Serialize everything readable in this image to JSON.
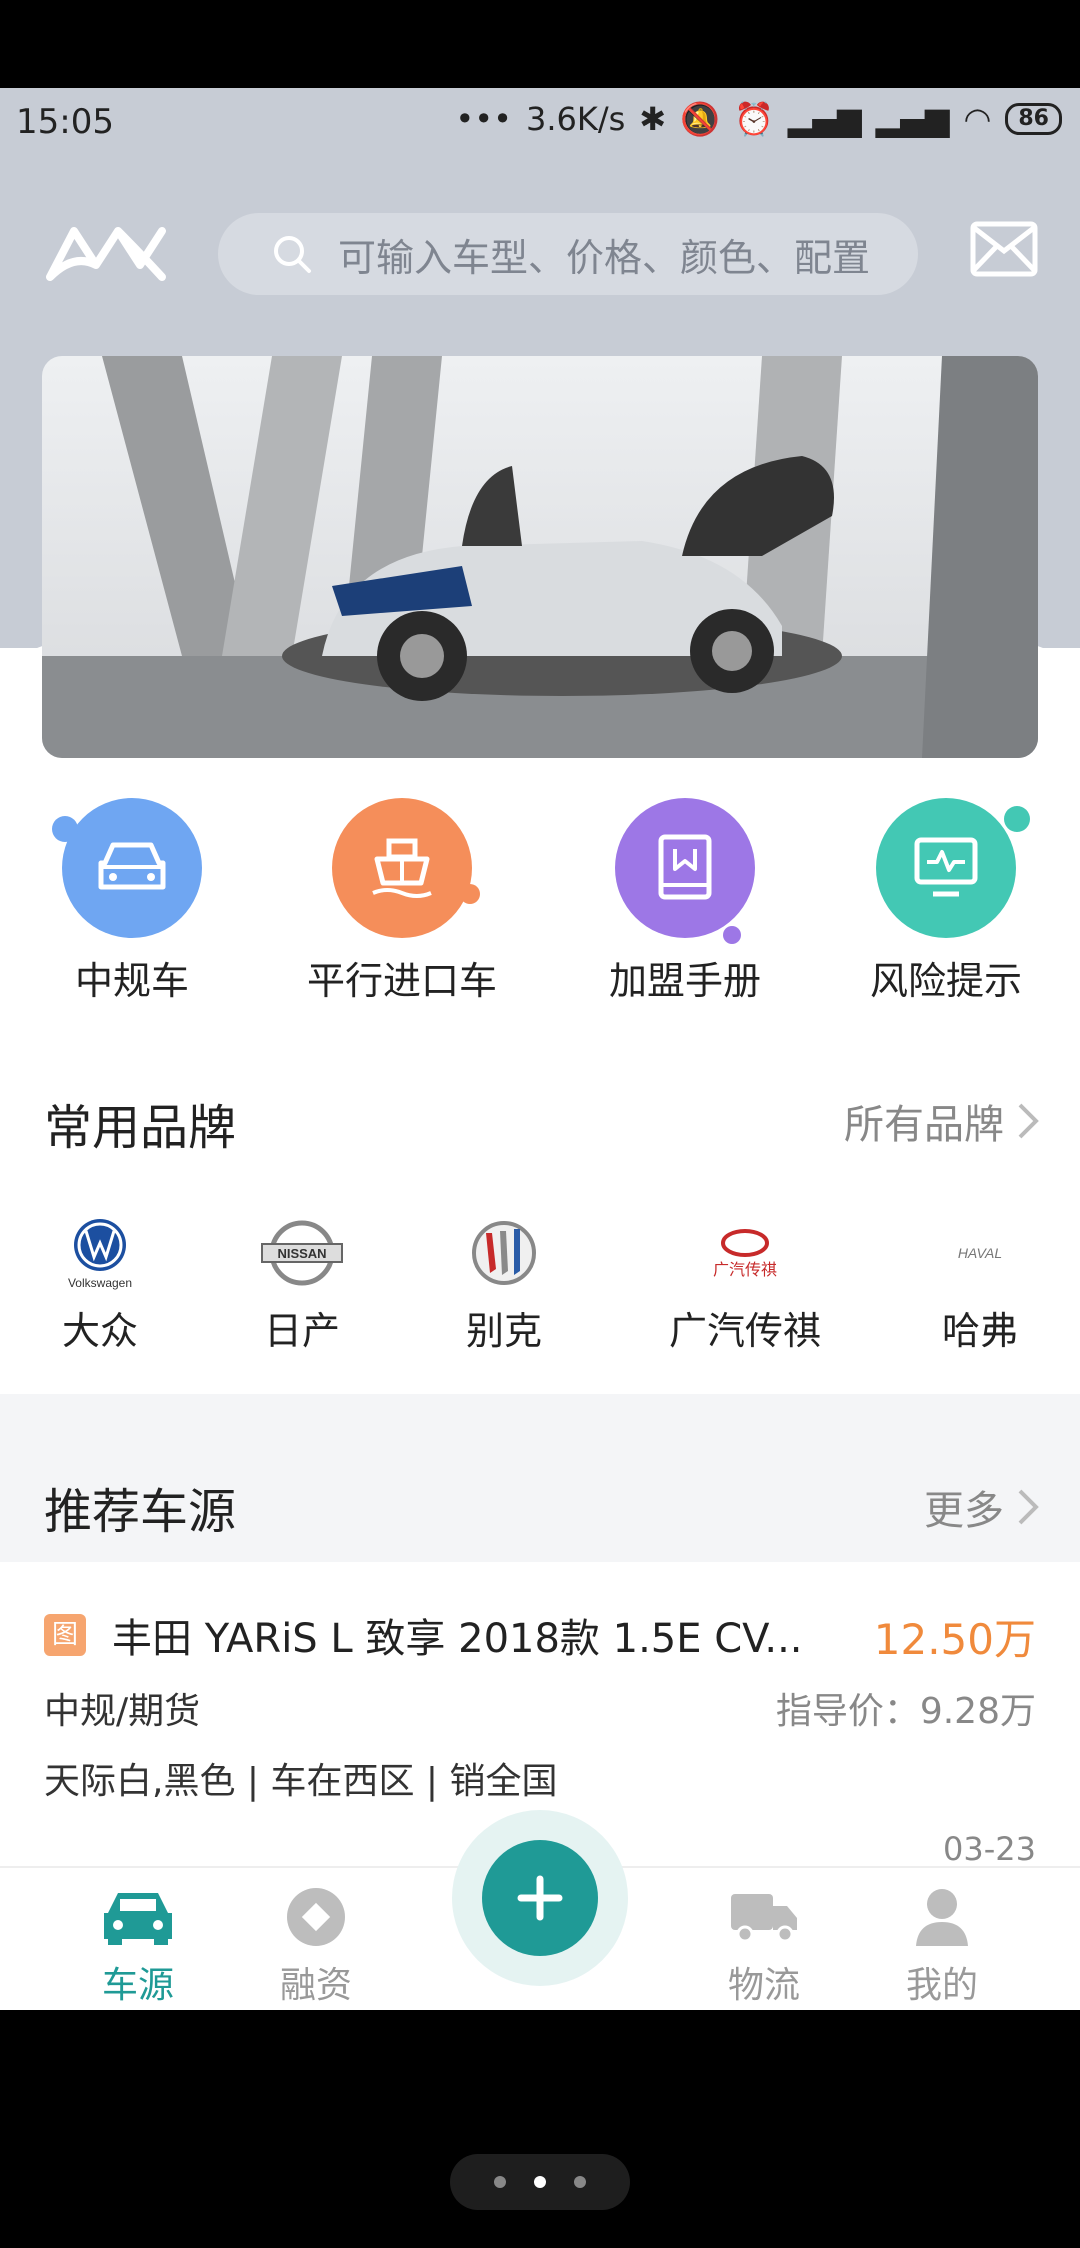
{
  "status_bar": {
    "time": "15:05",
    "network_speed": "3.6K/s",
    "battery": "86"
  },
  "search": {
    "placeholder": "可输入车型、价格、颜色、配置"
  },
  "categories": [
    {
      "label": "中规车",
      "icon": "car-icon",
      "color": "#6fa6f2"
    },
    {
      "label": "平行进口车",
      "icon": "ship-icon",
      "color": "#f58e5a"
    },
    {
      "label": "加盟手册",
      "icon": "book-icon",
      "color": "#9d77e6"
    },
    {
      "label": "风险提示",
      "icon": "monitor-icon",
      "color": "#43c8b4"
    }
  ],
  "brands_section": {
    "title": "常用品牌",
    "more": "所有品牌",
    "brands": [
      {
        "label": "大众",
        "logo_text": "Volkswagen"
      },
      {
        "label": "日产",
        "logo_text": "NISSAN"
      },
      {
        "label": "别克",
        "logo_text": ""
      },
      {
        "label": "广汽传祺",
        "logo_text": "广汽传祺"
      },
      {
        "label": "哈弗",
        "logo_text": "HAVAL"
      }
    ]
  },
  "recommend_section": {
    "title": "推荐车源",
    "more": "更多"
  },
  "listing": {
    "tag": "图",
    "title": "丰田 YARiS L 致享 2018款 1.5E CV...",
    "price": "12.50万",
    "type": "中规/期货",
    "guide_price": "指导价：9.28万",
    "info": "天际白,黑色 | 车在西区 | 销全国",
    "date": "03-23"
  },
  "tabs": [
    {
      "label": "车源",
      "icon": "car-icon",
      "active": true
    },
    {
      "label": "融资",
      "icon": "finance-icon",
      "active": false
    },
    {
      "label": "物流",
      "icon": "truck-icon",
      "active": false
    },
    {
      "label": "我的",
      "icon": "user-icon",
      "active": false
    }
  ],
  "colors": {
    "accent": "#1f9a96",
    "price": "#f08a3c"
  }
}
